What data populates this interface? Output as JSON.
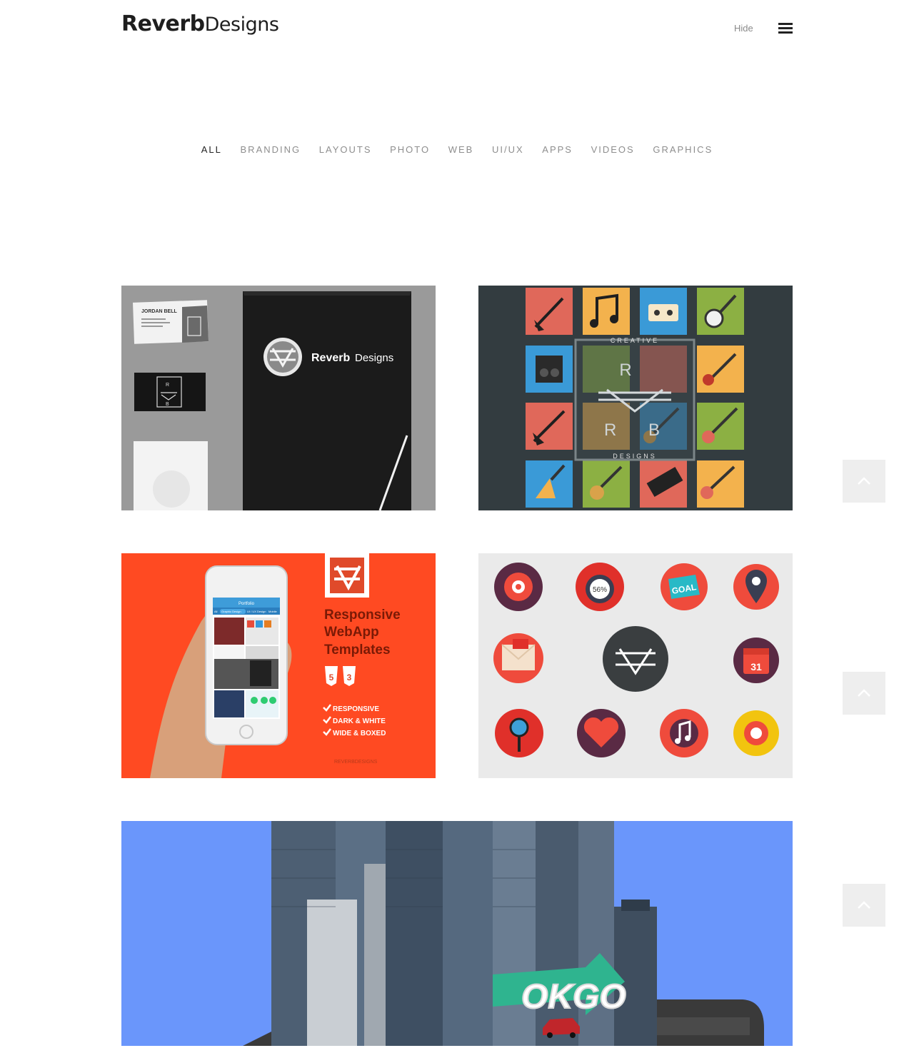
{
  "header": {
    "logo_bold": "Reverb",
    "logo_light": "Designs",
    "hide_label": "Hide"
  },
  "filters": [
    "ALL",
    "BRANDING",
    "LAYOUTS",
    "PHOTO",
    "WEB",
    "UI/UX",
    "APPS",
    "VIDEOS",
    "GRAPHICS"
  ],
  "active_filter": "ALL",
  "portfolio": {
    "branding": {
      "card_name": "JORDAN BELL",
      "folder_brand_bold": "Reverb",
      "folder_brand_light": "Designs",
      "logo_letters": [
        "R",
        "B"
      ]
    },
    "music": {
      "top_text": "CREATIVE",
      "bottom_text": "DESIGNS",
      "letters": [
        "R",
        "R",
        "B"
      ]
    },
    "webapp": {
      "heading_lines": [
        "Responsive",
        "WebApp",
        "Templates"
      ],
      "badges": [
        "5",
        "3"
      ],
      "features": [
        "RESPONSIVE",
        "DARK & WHITE",
        "WIDE & BOXED"
      ],
      "phone_title": "Portfolio",
      "phone_tabs": [
        "All",
        "Graphic Design",
        "UI / UX Design",
        "Mobile"
      ],
      "footer_brand": "REVERBDESIGNS"
    },
    "icons": {
      "percent_label": "56%",
      "goal_label": "GOAL",
      "calendar_day": "31"
    },
    "city": {
      "sign_text": "OKGO"
    }
  },
  "colors": {
    "accent_orange": "#ff4a22",
    "music_bg": "#333c40",
    "icons_bg": "#eaeaea",
    "city_sky": "#6a96fb",
    "scroll_button": "#eeeeee"
  }
}
